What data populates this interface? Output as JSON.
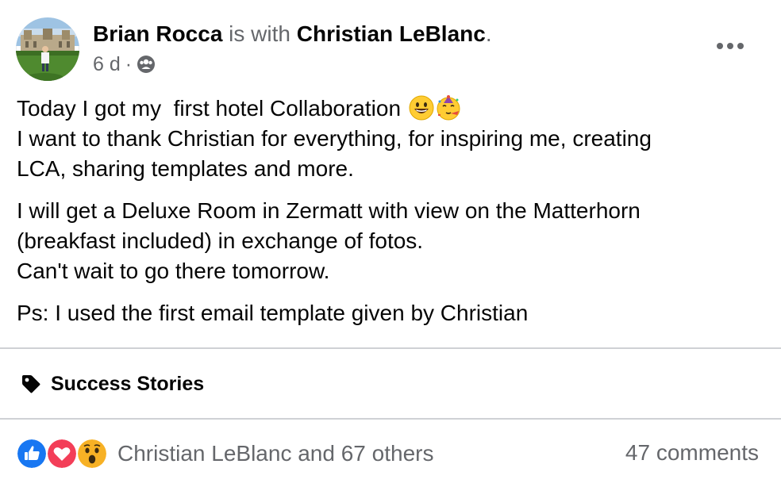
{
  "post": {
    "author": "Brian Rocca",
    "with_text": " is with ",
    "tagged": "Christian LeBlanc",
    "tagged_suffix": ".",
    "time": "6 d",
    "time_sep": "·",
    "audience_icon": "group-icon",
    "more_icon": "more-horizontal-icon",
    "body": [
      {
        "lines": [
          "Today I got my  first hotel Collaboration",
          "I want to thank Christian for everything, for inspiring me, creating",
          "LCA, sharing templates and more."
        ]
      },
      {
        "lines": [
          "I will get a Deluxe Room in Zermatt with view on the Matterhorn",
          "(breakfast included) in exchange of fotos.",
          "Can't wait to go there tomorrow."
        ]
      },
      {
        "lines": [
          "Ps: I used the first email template given by Christian"
        ]
      }
    ],
    "emojis": [
      "grinning-face-emoji",
      "partying-face-emoji"
    ]
  },
  "topic": {
    "icon": "tag-icon",
    "label": "Success Stories"
  },
  "footer": {
    "reaction_icons": [
      "like-icon",
      "love-icon",
      "wow-icon"
    ],
    "reactors": "Christian LeBlanc and 67 others",
    "comments": "47 comments"
  },
  "colors": {
    "text": "#050505",
    "secondary": "#65676b",
    "divider": "#cfd1d5",
    "like": "#1877f2",
    "love": "#f33e58",
    "wow": "#f7b125"
  }
}
